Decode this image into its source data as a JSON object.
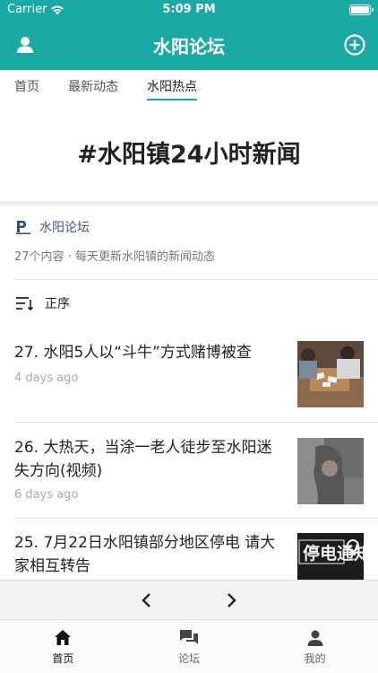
{
  "status_bar": {
    "carrier": "Carrier",
    "time": "5:09 PM"
  },
  "nav": {
    "title": "水阳论坛",
    "left_icon": "user-icon",
    "right_icon": "add-circle-icon"
  },
  "tabs": [
    {
      "label": "首页",
      "active": false
    },
    {
      "label": "最新动态",
      "active": false
    },
    {
      "label": "水阳热点",
      "active": true
    }
  ],
  "hero": {
    "title": "#水阳镇24小时新闻"
  },
  "forum": {
    "name": "水阳论坛",
    "description": "27个内容 · 每天更新水阳镇的新闻动态"
  },
  "sort": {
    "label": "正序",
    "icon": "sort-icon"
  },
  "items": [
    {
      "headline": "27. 水阳5人以“斗牛”方式赌博被查",
      "ago": "4 days ago"
    },
    {
      "headline": "26. 大热天，当涂一老人徒步至水阳迷失方向(视频)",
      "ago": "6 days ago"
    },
    {
      "headline": "25. 7月22日水阳镇部分地区停电 请大家相互转告",
      "ago": "",
      "thumb_text": "停电通知"
    }
  ],
  "pager": {
    "prev_icon": "chevron-left-icon",
    "next_icon": "chevron-right-icon"
  },
  "tabbar": [
    {
      "label": "首页",
      "icon": "home-icon",
      "active": true
    },
    {
      "label": "论坛",
      "icon": "forum-icon",
      "active": false
    },
    {
      "label": "我的",
      "icon": "profile-icon",
      "active": false
    }
  ],
  "colors": {
    "accent": "#1aa9a4",
    "link": "#3a5a8c"
  }
}
